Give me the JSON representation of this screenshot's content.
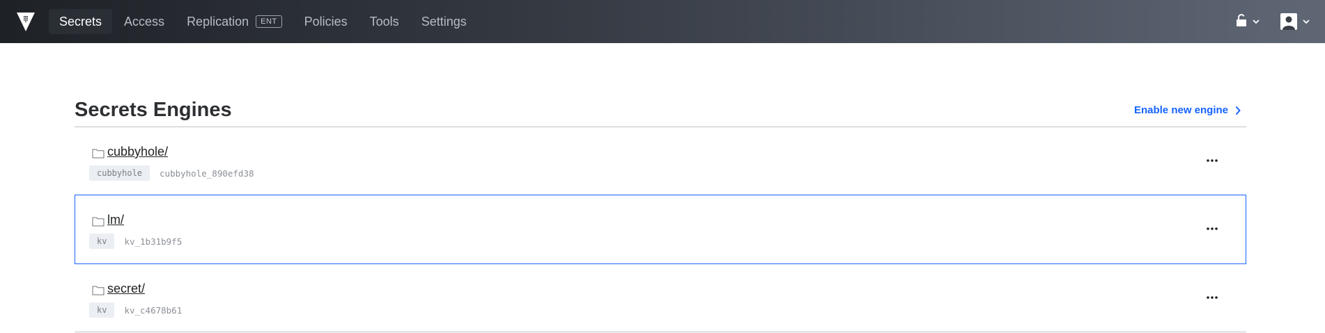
{
  "brand": {
    "logo_icon": "vault-logo-icon"
  },
  "nav": {
    "items": [
      {
        "label": "Secrets",
        "active": true
      },
      {
        "label": "Access",
        "active": false
      },
      {
        "label": "Replication",
        "active": false,
        "badge": "ENT"
      },
      {
        "label": "Policies",
        "active": false
      },
      {
        "label": "Tools",
        "active": false
      },
      {
        "label": "Settings",
        "active": false
      }
    ]
  },
  "top_right": {
    "status_icon": "unlock-icon",
    "user_icon": "user-avatar-icon",
    "chevron_icon": "chevron-down-icon"
  },
  "page": {
    "title": "Secrets Engines",
    "enable_link": "Enable new engine",
    "enable_link_icon": "chevron-right-icon"
  },
  "engines": [
    {
      "path": "cubbyhole/",
      "type": "cubbyhole",
      "accessor": "cubbyhole_890efd38",
      "focused": false
    },
    {
      "path": "lm/",
      "type": "kv",
      "accessor": "kv_1b31b9f5",
      "focused": true
    },
    {
      "path": "secret/",
      "type": "kv",
      "accessor": "kv_c4678b61",
      "focused": false
    }
  ],
  "colors": {
    "accent": "#1563ff",
    "nav_bg_start": "#1e2126",
    "nav_bg_end": "#5f6775"
  }
}
